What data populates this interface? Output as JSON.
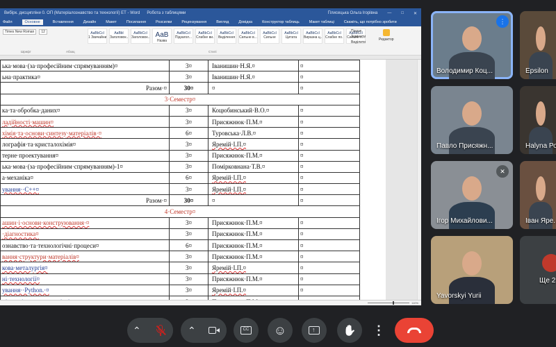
{
  "word": {
    "titlebar": {
      "left_text": "Вибірк. дисципліни 0. ОП (Матеріалознавство та технології) ЕТ - Word",
      "tab_text": "Робота з таблицями",
      "user_text": "Плисецька Ольга Ігорівна",
      "share_text": "Поділитися"
    },
    "tabs": [
      "Файл",
      "Основне",
      "Вставлення",
      "Дизайн",
      "Макет",
      "Посилання",
      "Розсилки",
      "Рецензування",
      "Вигляд",
      "Довідка",
      "Конструктор таблиць",
      "Макет таблиці"
    ],
    "active_tab": "Основне",
    "tell_me": "Скажіть, що потрібно зробити",
    "ribbon": {
      "styles": [
        {
          "preview": "AaBbCcl",
          "name": "1 Звичайни..."
        },
        {
          "preview": "AaBbl",
          "name": "Заголовок..."
        },
        {
          "preview": "AaBbCcl",
          "name": "Заголовок..."
        },
        {
          "preview": "AaB",
          "name": "Назва",
          "big": true
        },
        {
          "preview": "AaBbCcl",
          "name": "Підзагол..."
        },
        {
          "preview": "AaBbCcl",
          "name": "Слабке ви..."
        },
        {
          "preview": "AaBbCcl",
          "name": "Виділення"
        },
        {
          "preview": "AaBbCcl",
          "name": "Сильне в..."
        },
        {
          "preview": "AaBbCcl",
          "name": "Сильне"
        },
        {
          "preview": "AaBbCcl",
          "name": "Цитата"
        },
        {
          "preview": "AaBbCcl",
          "name": "Виразна ц..."
        },
        {
          "preview": "AaBbCcl",
          "name": "Слабке по..."
        },
        {
          "preview": "AaBbCcl",
          "name": "Сильне п..."
        }
      ],
      "groups": [
        "Шрифт",
        "Абзац",
        "Стилі"
      ],
      "find": "Пошук",
      "replace": "Замінити",
      "select": "Виділити",
      "editor": "Редактор"
    },
    "table_rows": [
      {
        "type": "row",
        "c1": "ька·мова·(за·професійним·спрямуванням)¤",
        "c1_class": "",
        "c2": "3¤",
        "c3": "Іванишин·Н.Я.¤",
        "c3_class": "",
        "c4": "¤"
      },
      {
        "type": "row",
        "c1": "ьна·практика¤",
        "c1_class": "",
        "c2": "3¤",
        "c3": "Іванишин·Н.Я.¤",
        "c3_class": "",
        "c4": "¤"
      },
      {
        "type": "total",
        "c1": "Разом·¤",
        "c2": "30¤",
        "c3": "¤",
        "c3_class": "",
        "c4": "¤"
      },
      {
        "type": "sem",
        "c1": "3·Семестр¤"
      },
      {
        "type": "row",
        "c1": "ка·та·обробка·даних¤",
        "c1_class": "",
        "c2": "3¤",
        "c3": "Коцюбинський·В.О.¤",
        "c3_class": "",
        "c4": "¤"
      },
      {
        "type": "row",
        "c1": "ладійності·машин¤",
        "c1_class": "red u",
        "c2": "3¤",
        "c3": "Присяжнюк·П.М.¤",
        "c3_class": "",
        "c4": "¤"
      },
      {
        "type": "row",
        "c1": "хімія·та·основи·синтезу·матеріалів·¤",
        "c1_class": "red u",
        "c2": "6¤",
        "c3": "Туровська·Л.В.¤",
        "c3_class": "",
        "c4": "¤"
      },
      {
        "type": "row",
        "c1": "лографія·та·кристалохімія¤",
        "c1_class": "",
        "c2": "3¤",
        "c3": "Яремій·І.П.¤",
        "c3_class": "u",
        "c4": "¤"
      },
      {
        "type": "row",
        "c1": "терне·проектування¤",
        "c1_class": "",
        "c2": "3¤",
        "c3": "Присяжнюк·П.М.¤",
        "c3_class": "",
        "c4": "¤"
      },
      {
        "type": "row",
        "c1": "ька·мова·(за·професійним·спрямуванням)-1¤",
        "c1_class": "",
        "c2": "3¤",
        "c3": "Помірковнана·Т.В.¤",
        "c3_class": "",
        "c4": "¤"
      },
      {
        "type": "row",
        "c1": "а·механіка¤",
        "c1_class": "",
        "c2": "6¤",
        "c3": "Яремій·І.П.¤",
        "c3_class": "u",
        "c4": "¤"
      },
      {
        "type": "row",
        "c1": "ування··С++¤",
        "c1_class": "blue u",
        "c2": "3¤",
        "c3": "Яремій·І.П.¤",
        "c3_class": "u",
        "c4": "¤"
      },
      {
        "type": "total",
        "c1": "Разом·¤",
        "c2": "30¤",
        "c3": "¤",
        "c3_class": "",
        "c4": "¤"
      },
      {
        "type": "sem",
        "c1": "4·Семестр¤"
      },
      {
        "type": "row",
        "c1": "ашин·і·основи·конструювання·¤",
        "c1_class": "red u",
        "c2": "3¤",
        "c3": "Присяжнюк·П.М.¤",
        "c3_class": "",
        "c4": "¤"
      },
      {
        "type": "row",
        "c1": "·діагностика¤",
        "c1_class": "red u",
        "c2": "3¤",
        "c3": "Присяжнюк·П.М.¤",
        "c3_class": "",
        "c4": "¤"
      },
      {
        "type": "row",
        "c1": "ознавство·та·технологічні·процеси¤",
        "c1_class": "",
        "c2": "6¤",
        "c3": "Присяжнюк·П.М.¤",
        "c3_class": "",
        "c4": "¤"
      },
      {
        "type": "row",
        "c1": "вання·структури·матеріалів¤",
        "c1_class": "red u",
        "c2": "3¤",
        "c3": "Присяжнюк·П.М.¤",
        "c3_class": "",
        "c4": "¤"
      },
      {
        "type": "row",
        "c1": "кова·металургія¤",
        "c1_class": "blue u",
        "c2": "3¤",
        "c3": "Яремій·І.П.¤",
        "c3_class": "u",
        "c4": "¤"
      },
      {
        "type": "row",
        "c1": "ні·технології¤",
        "c1_class": "blue u",
        "c2": "3¤",
        "c3": "Присяжнюк·П.М.¤",
        "c3_class": "",
        "c4": "¤"
      },
      {
        "type": "row",
        "c1": "ування··Python.·¤",
        "c1_class": "blue u",
        "c2": "3¤",
        "c3": "Яремій·І.П.¤",
        "c3_class": "u",
        "c4": "¤"
      },
      {
        "type": "row",
        "c1": "ні·дослідження·матеріалів¤",
        "c1_class": "blue u",
        "c2": "3¤",
        "c3": "Присяжнюк·П.М.¤",
        "c3_class": "",
        "c4": "¤"
      }
    ],
    "status": {
      "zoom": "110%"
    }
  },
  "participants": [
    {
      "name": "Володимир Коц...",
      "bg": "#6b7d8c",
      "speaking": true
    },
    {
      "name": "Epsilon",
      "bg": "#5a4a3a",
      "speaking": false
    },
    {
      "name": "Павло Присяжн...",
      "bg": "#7a8590",
      "speaking": false
    },
    {
      "name": "Halyna Ро...",
      "bg": "#3a3530",
      "speaking": false
    },
    {
      "name": "Ігор Михайлови...",
      "bg": "#8a8f95",
      "speaking": false,
      "muted": true
    },
    {
      "name": "Іван Яре...",
      "bg": "#6a5040",
      "speaking": false
    },
    {
      "name": "Yavorskyi Yurii",
      "bg": "#b8a07a",
      "speaking": false
    },
    {
      "name": "Ще 2...",
      "bg": "#3c4043",
      "speaking": false
    }
  ],
  "controls": {
    "end_call_color": "#ea4335",
    "mic_muted_color": "#f9dedc",
    "buttons": [
      "chevron-up",
      "mic-off",
      "chevron-up",
      "camera",
      "captions",
      "emoji",
      "present",
      "raise-hand",
      "more",
      "end-call"
    ]
  },
  "icons": {
    "mic_off": "🎤",
    "camera": "▭",
    "captions": "CC",
    "emoji": "☺",
    "present": "⊞",
    "hand": "✋",
    "more": "⋮",
    "end_call": "☎",
    "chevron": "⌃",
    "dots": "⋯",
    "x_mark": "✕"
  }
}
